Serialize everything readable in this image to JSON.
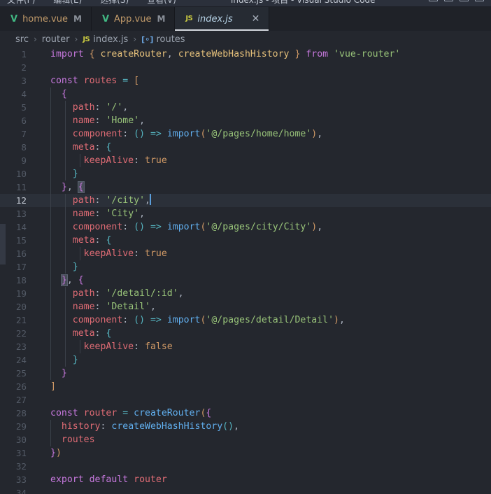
{
  "window": {
    "menu_items": [
      "文件(F)",
      "编辑(E)",
      "选择(S)",
      "查看(V)"
    ],
    "center_title": "index.js - 项目 - Visual Studio Code",
    "window_buttons": [
      "restore-down",
      "minimize",
      "maximize",
      "close"
    ]
  },
  "tabs": [
    {
      "icon": "vue-icon",
      "icon_glyph": "V",
      "label": "home.vue",
      "badge": "M",
      "active": false,
      "closable": false
    },
    {
      "icon": "vue-icon",
      "icon_glyph": "V",
      "label": "App.vue",
      "badge": "M",
      "active": false,
      "closable": false
    },
    {
      "icon": "js-icon",
      "icon_glyph": "JS",
      "label": "index.js",
      "badge": "",
      "active": true,
      "closable": true,
      "close_glyph": "✕"
    }
  ],
  "breadcrumb": {
    "separator": "›",
    "segments": [
      {
        "label": "src",
        "icon": ""
      },
      {
        "label": "router",
        "icon": ""
      },
      {
        "label": "index.js",
        "icon": "js-icon",
        "icon_glyph": "JS"
      },
      {
        "label": "routes",
        "icon": "symbol-variable-icon",
        "icon_glyph": "[⚬]"
      }
    ]
  },
  "editor": {
    "language": "javascript",
    "active_line": 12,
    "cursor_line": 12,
    "cursor_column": 18,
    "total_lines_visible": 34,
    "lines": [
      {
        "n": 1,
        "text": "import { createRouter, createWebHashHistory } from 'vue-router'"
      },
      {
        "n": 2,
        "text": ""
      },
      {
        "n": 3,
        "text": "const routes = ["
      },
      {
        "n": 4,
        "text": "  {"
      },
      {
        "n": 5,
        "text": "    path: '/',"
      },
      {
        "n": 6,
        "text": "    name: 'Home',"
      },
      {
        "n": 7,
        "text": "    component: () => import('@/pages/home/home'),"
      },
      {
        "n": 8,
        "text": "    meta: {"
      },
      {
        "n": 9,
        "text": "      keepAlive: true"
      },
      {
        "n": 10,
        "text": "    }"
      },
      {
        "n": 11,
        "text": "  }, {"
      },
      {
        "n": 12,
        "text": "    path: '/city',"
      },
      {
        "n": 13,
        "text": "    name: 'City',"
      },
      {
        "n": 14,
        "text": "    component: () => import('@/pages/city/City'),"
      },
      {
        "n": 15,
        "text": "    meta: {"
      },
      {
        "n": 16,
        "text": "      keepAlive: true"
      },
      {
        "n": 17,
        "text": "    }"
      },
      {
        "n": 18,
        "text": "  }, {"
      },
      {
        "n": 19,
        "text": "    path: '/detail/:id',"
      },
      {
        "n": 20,
        "text": "    name: 'Detail',"
      },
      {
        "n": 21,
        "text": "    component: () => import('@/pages/detail/Detail'),"
      },
      {
        "n": 22,
        "text": "    meta: {"
      },
      {
        "n": 23,
        "text": "      keepAlive: false"
      },
      {
        "n": 24,
        "text": "    }"
      },
      {
        "n": 25,
        "text": "  }"
      },
      {
        "n": 26,
        "text": "]"
      },
      {
        "n": 27,
        "text": ""
      },
      {
        "n": 28,
        "text": "const router = createRouter({"
      },
      {
        "n": 29,
        "text": "  history: createWebHashHistory(),"
      },
      {
        "n": 30,
        "text": "  routes"
      },
      {
        "n": 31,
        "text": "})"
      },
      {
        "n": 32,
        "text": ""
      },
      {
        "n": 33,
        "text": "export default router"
      },
      {
        "n": 34,
        "text": ""
      }
    ]
  },
  "colors": {
    "editor_background": "#24272e",
    "tabbar_background": "#1f2228",
    "active_tab_background": "#262b33",
    "active_line_background": "#2b3039",
    "keyword": "#c678dd",
    "function": "#61afef",
    "string": "#98c379",
    "property": "#e06c75",
    "variable": "#e5c07b",
    "operator": "#56b6c2",
    "boolean": "#d19a66",
    "line_number": "#535a66",
    "cursor": "#5b9dd9",
    "vue_icon": "#41b883",
    "js_icon": "#cbcb41"
  }
}
